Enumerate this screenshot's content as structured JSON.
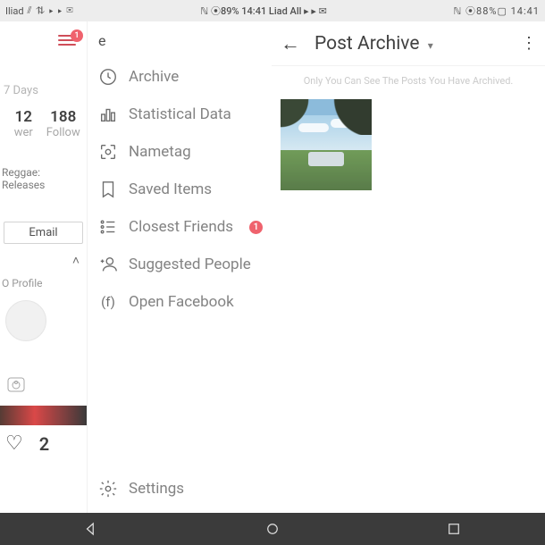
{
  "status_bar": {
    "carrier": "Iliad",
    "signal_icons": "⫽ ⇅ ▸ ▸ ✉",
    "center": "ℕ ⦿89% 14:41 Liad All ▸ ▸ ✉",
    "right_icons": "ℕ ⦿88%▢ 14:41"
  },
  "profile": {
    "hamburger_badge": "1",
    "days": "7 Days",
    "stat1_num": "12",
    "stat1_lbl": "wer",
    "stat2_num": "188",
    "stat2_lbl": "Follow",
    "reggae": "Reggae: Releases",
    "email": "Email",
    "chevron": "˄",
    "oprofile": "O Profile",
    "like_count": "2"
  },
  "menu": {
    "handle": "e",
    "items": {
      "archive": "Archive",
      "stats": "Statistical Data",
      "nametag": "Nametag",
      "saved": "Saved Items",
      "close_friends": "Closest Friends",
      "close_friends_badge": "1",
      "suggested": "Suggested People",
      "facebook": "Open Facebook",
      "settings": "Settings"
    }
  },
  "archive": {
    "title": "Post Archive",
    "caret": "▾",
    "more": "⋮",
    "subtitle": "Only You Can See The Posts You Have Archived."
  },
  "icons": {
    "fb_prefix": "(f)"
  }
}
